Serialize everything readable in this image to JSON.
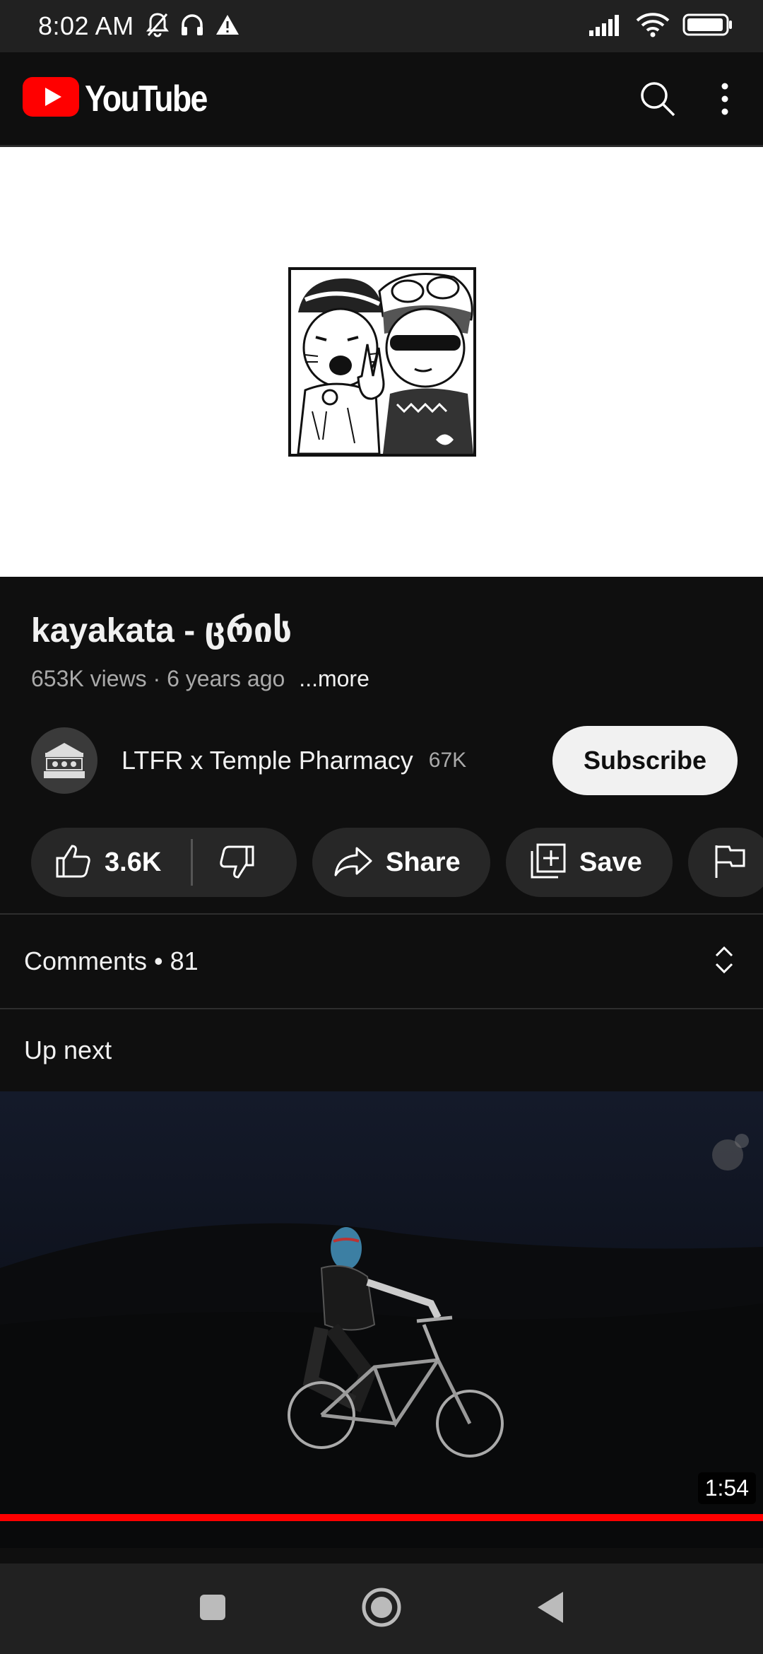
{
  "status_bar": {
    "time": "8:02 AM",
    "icons_left": [
      "bell-muted-icon",
      "headphones-icon",
      "warning-icon"
    ],
    "icons_right": [
      "signal-icon",
      "wifi-icon",
      "battery-icon"
    ]
  },
  "app_bar": {
    "logo_text": "YouTube",
    "brand_color": "#ff0000",
    "icons": [
      "search-icon",
      "more-vert-icon"
    ]
  },
  "video": {
    "title": "kayakata - ცრის",
    "views": "653K views",
    "age": "6 years ago",
    "meta_separator": " · ",
    "more_label": "...more"
  },
  "channel": {
    "name": "LTFR x Temple Pharmacy",
    "subscribers": "67K",
    "subscribe_label": "Subscribe"
  },
  "actions": {
    "like_count": "3.6K",
    "share_label": "Share",
    "save_label": "Save"
  },
  "comments": {
    "label": "Comments • 81"
  },
  "up_next": {
    "label": "Up next",
    "duration": "1:54",
    "progress_fraction": 1.0
  },
  "nav_bar": {
    "icons": [
      "recents-icon",
      "home-icon",
      "back-icon"
    ]
  }
}
